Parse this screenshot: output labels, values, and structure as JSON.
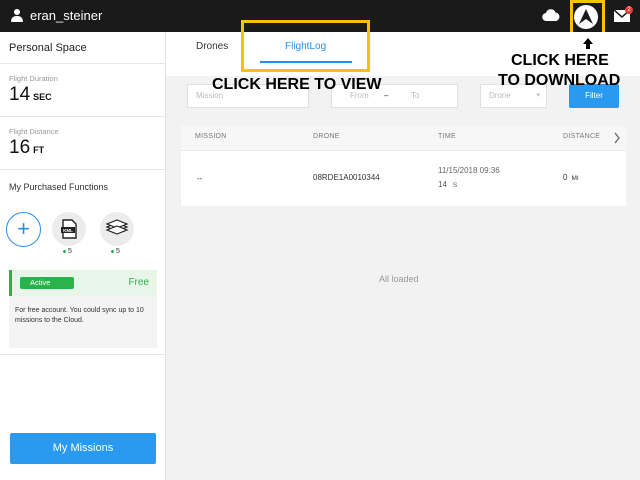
{
  "header": {
    "username": "eran_steiner",
    "icons": [
      "user-icon",
      "cloud-icon",
      "download-icon",
      "mail-icon"
    ],
    "mail_badge": "2"
  },
  "sidebar": {
    "title": "Personal Space",
    "flight_duration": {
      "label": "Flight Duration",
      "value": "14",
      "unit": "SEC"
    },
    "flight_distance": {
      "label": "Flight Distance",
      "value": "16",
      "unit": "FT"
    },
    "functions_title": "My Purchased Functions",
    "add_label": "+",
    "functions": [
      {
        "icon": "kml-icon",
        "count": "5"
      },
      {
        "icon": "layers-icon",
        "count": "5"
      }
    ],
    "plan": {
      "status": "Active",
      "tier": "Free",
      "description": "For free account. You could sync up to 10 missions to the Cloud."
    },
    "missions_button": "My Missions"
  },
  "tabs": [
    {
      "label": "Drones",
      "active": false
    },
    {
      "label": "FlightLog",
      "active": true
    }
  ],
  "filters": {
    "mission_placeholder": "Mission",
    "from_placeholder": "From",
    "date_separator": "–",
    "to_placeholder": "To",
    "drone_placeholder": "Drone",
    "filter_button": "Filter"
  },
  "table": {
    "columns": [
      "MISSION",
      "DRONE",
      "TIME",
      "DISTANCE"
    ],
    "rows": [
      {
        "mission": "--",
        "drone": "08RDE1A0010344",
        "date": "11/15/2018 09:36",
        "duration": "14",
        "duration_unit": "S",
        "distance": "0",
        "distance_unit": "MI"
      }
    ],
    "footer": "All loaded"
  },
  "annotations": {
    "view": "CLICK HERE TO VIEW",
    "download_line1": "CLICK HERE",
    "download_line2": "TO DOWNLOAD"
  },
  "colors": {
    "accent": "#2a9af0",
    "highlight": "#f5c400",
    "active_green": "#2ab34a"
  }
}
